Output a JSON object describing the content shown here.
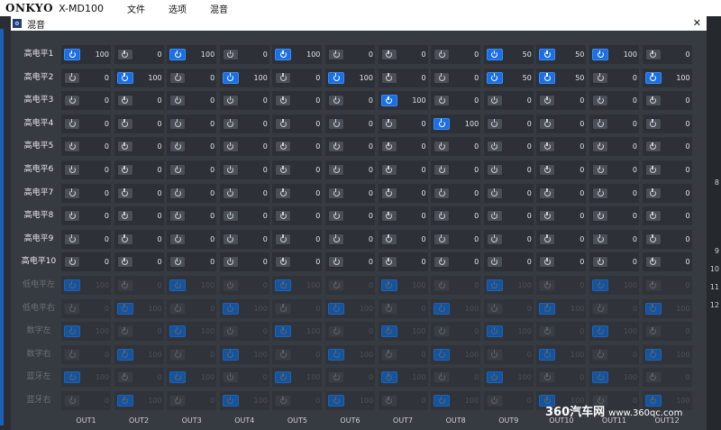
{
  "app": {
    "logo": "ONKYO",
    "model": "X-MD100",
    "menu": [
      "文件",
      "选项",
      "混音"
    ]
  },
  "dialog": {
    "title": "混音",
    "close": "✕",
    "icon": "app-icon"
  },
  "side_numbers": [
    "8",
    "9",
    "10",
    "11",
    "12"
  ],
  "columns": [
    "OUT1",
    "OUT2",
    "OUT3",
    "OUT4",
    "OUT5",
    "OUT6",
    "OUT7",
    "OUT8",
    "OUT9",
    "OUT10",
    "OUT11",
    "OUT12"
  ],
  "rows": [
    {
      "label": "高电平1",
      "dim": false,
      "on": [
        1,
        0,
        1,
        0,
        1,
        0,
        0,
        0,
        1,
        1,
        1,
        0
      ],
      "values": [
        "100",
        "0",
        "100",
        "0",
        "100",
        "0",
        "0",
        "0",
        "50",
        "50",
        "100",
        "0"
      ]
    },
    {
      "label": "高电平2",
      "dim": false,
      "on": [
        0,
        1,
        0,
        1,
        0,
        1,
        0,
        0,
        1,
        1,
        0,
        1
      ],
      "values": [
        "0",
        "100",
        "0",
        "100",
        "0",
        "100",
        "0",
        "0",
        "50",
        "50",
        "0",
        "100"
      ]
    },
    {
      "label": "高电平3",
      "dim": false,
      "on": [
        0,
        0,
        0,
        0,
        0,
        0,
        1,
        0,
        0,
        0,
        0,
        0
      ],
      "values": [
        "0",
        "0",
        "0",
        "0",
        "0",
        "0",
        "100",
        "0",
        "0",
        "0",
        "0",
        "0"
      ]
    },
    {
      "label": "高电平4",
      "dim": false,
      "on": [
        0,
        0,
        0,
        0,
        0,
        0,
        0,
        1,
        0,
        0,
        0,
        0
      ],
      "values": [
        "0",
        "0",
        "0",
        "0",
        "0",
        "0",
        "0",
        "100",
        "0",
        "0",
        "0",
        "0"
      ]
    },
    {
      "label": "高电平5",
      "dim": false,
      "on": [
        0,
        0,
        0,
        0,
        0,
        0,
        0,
        0,
        0,
        0,
        0,
        0
      ],
      "values": [
        "0",
        "0",
        "0",
        "0",
        "0",
        "0",
        "0",
        "0",
        "0",
        "0",
        "0",
        "0"
      ]
    },
    {
      "label": "高电平6",
      "dim": false,
      "on": [
        0,
        0,
        0,
        0,
        0,
        0,
        0,
        0,
        0,
        0,
        0,
        0
      ],
      "values": [
        "0",
        "0",
        "0",
        "0",
        "0",
        "0",
        "0",
        "0",
        "0",
        "0",
        "0",
        "0"
      ]
    },
    {
      "label": "高电平7",
      "dim": false,
      "on": [
        0,
        0,
        0,
        0,
        0,
        0,
        0,
        0,
        0,
        0,
        0,
        0
      ],
      "values": [
        "0",
        "0",
        "0",
        "0",
        "0",
        "0",
        "0",
        "0",
        "0",
        "0",
        "0",
        "0"
      ]
    },
    {
      "label": "高电平8",
      "dim": false,
      "on": [
        0,
        0,
        0,
        0,
        0,
        0,
        0,
        0,
        0,
        0,
        0,
        0
      ],
      "values": [
        "0",
        "0",
        "0",
        "0",
        "0",
        "0",
        "0",
        "0",
        "0",
        "0",
        "0",
        "0"
      ]
    },
    {
      "label": "高电平9",
      "dim": false,
      "on": [
        0,
        0,
        0,
        0,
        0,
        0,
        0,
        0,
        0,
        0,
        0,
        0
      ],
      "values": [
        "0",
        "0",
        "0",
        "0",
        "0",
        "0",
        "0",
        "0",
        "0",
        "0",
        "0",
        "0"
      ]
    },
    {
      "label": "高电平10",
      "dim": false,
      "on": [
        0,
        0,
        0,
        0,
        0,
        0,
        0,
        0,
        0,
        0,
        0,
        0
      ],
      "values": [
        "0",
        "0",
        "0",
        "0",
        "0",
        "0",
        "0",
        "0",
        "0",
        "0",
        "0",
        "0"
      ]
    },
    {
      "label": "低电平左",
      "dim": true,
      "on": [
        1,
        0,
        1,
        0,
        1,
        0,
        1,
        0,
        1,
        0,
        1,
        0
      ],
      "values": [
        "100",
        "0",
        "100",
        "0",
        "100",
        "0",
        "100",
        "0",
        "100",
        "0",
        "100",
        "0"
      ]
    },
    {
      "label": "低电平右",
      "dim": true,
      "on": [
        0,
        1,
        0,
        1,
        0,
        1,
        0,
        1,
        0,
        1,
        0,
        1
      ],
      "values": [
        "0",
        "100",
        "0",
        "100",
        "0",
        "100",
        "0",
        "100",
        "0",
        "100",
        "0",
        "100"
      ]
    },
    {
      "label": "数字左",
      "dim": true,
      "on": [
        1,
        0,
        1,
        0,
        1,
        0,
        1,
        0,
        1,
        0,
        1,
        0
      ],
      "values": [
        "100",
        "0",
        "100",
        "0",
        "100",
        "0",
        "100",
        "0",
        "100",
        "0",
        "100",
        "0"
      ]
    },
    {
      "label": "数字右",
      "dim": true,
      "on": [
        0,
        1,
        0,
        1,
        0,
        1,
        0,
        1,
        0,
        1,
        0,
        1
      ],
      "values": [
        "0",
        "100",
        "0",
        "100",
        "0",
        "100",
        "0",
        "100",
        "0",
        "100",
        "0",
        "100"
      ]
    },
    {
      "label": "蓝牙左",
      "dim": true,
      "on": [
        1,
        0,
        1,
        0,
        1,
        0,
        1,
        0,
        1,
        0,
        1,
        0
      ],
      "values": [
        "100",
        "0",
        "100",
        "0",
        "100",
        "0",
        "100",
        "0",
        "100",
        "0",
        "100",
        "0"
      ]
    },
    {
      "label": "蓝牙右",
      "dim": true,
      "on": [
        0,
        1,
        0,
        1,
        0,
        1,
        0,
        1,
        0,
        1,
        0,
        1
      ],
      "values": [
        "0",
        "100",
        "0",
        "100",
        "0",
        "100",
        "0",
        "100",
        "0",
        "100",
        "0",
        "100"
      ]
    }
  ],
  "watermark": {
    "text": "360汽车网",
    "url": "www.360qc.com"
  },
  "colors": {
    "accent": "#1a6ee6",
    "background": "#363a41",
    "cell": "#2d3137"
  }
}
